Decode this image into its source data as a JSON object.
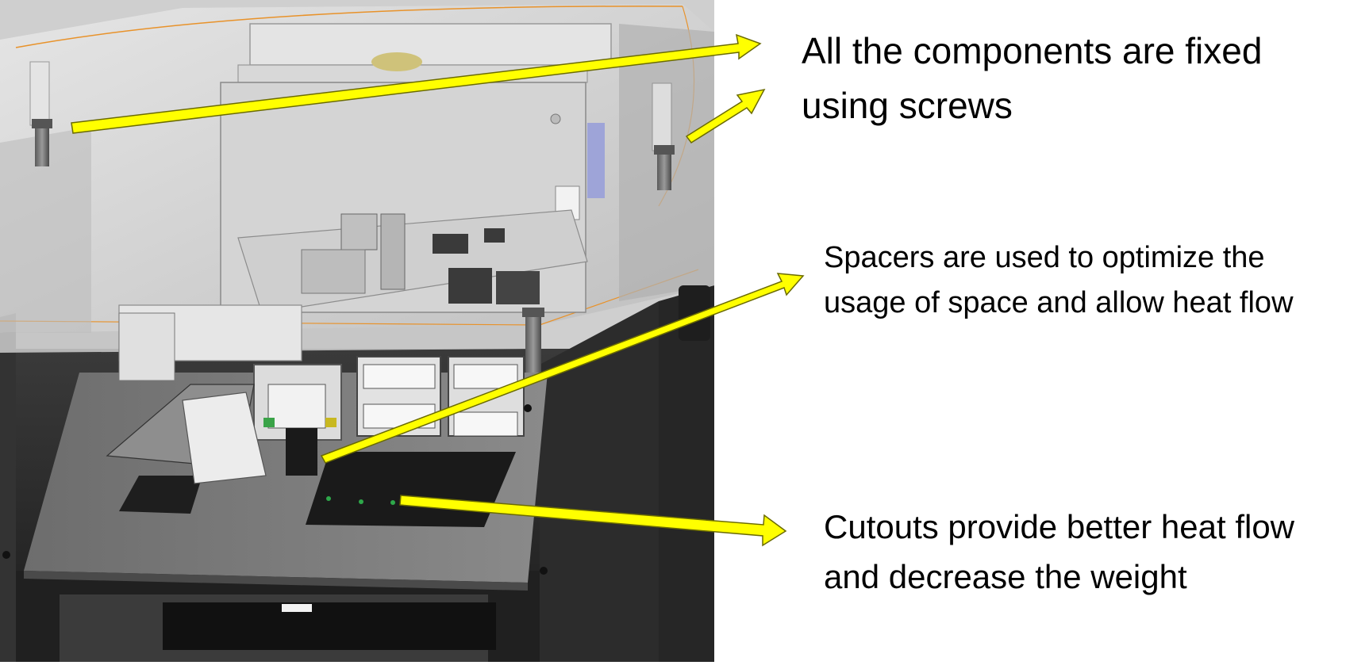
{
  "callouts": {
    "screws": {
      "line1": "All the components are fixed",
      "line2": "using screws"
    },
    "spacers": {
      "line1": "Spacers are used to optimize the",
      "line2": "usage of space and allow heat flow"
    },
    "cutouts": {
      "line1": "Cutouts provide better heat flow",
      "line2": "and decrease the weight"
    }
  },
  "colors": {
    "arrow_fill": "#ffff00",
    "arrow_stroke": "#6b6b00",
    "enclosure_dark": "#2a2a2a",
    "translucent_shell": "#d9d9d9",
    "pcb": "#c8c8c8",
    "outline_orange": "#e8922a"
  },
  "icons": {
    "arrow": "callout-arrow-icon",
    "screw": "screw-icon"
  }
}
